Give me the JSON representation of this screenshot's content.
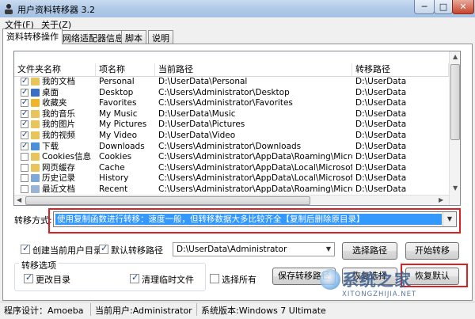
{
  "window": {
    "title": "用户资料转移器 3.2",
    "controls": {
      "minimize": "─",
      "maximize": "□",
      "close": "✕"
    }
  },
  "menu": [
    {
      "label": "文件(F)"
    },
    {
      "label": "关于(Z)"
    }
  ],
  "tabs": [
    {
      "label": "资料转移操作",
      "active": true
    },
    {
      "label": "网络适配器信息",
      "active": false
    },
    {
      "label": "脚本",
      "active": false
    },
    {
      "label": "说明",
      "active": false
    }
  ],
  "table": {
    "columns": [
      "文件夹名称",
      "项名称",
      "当前路径",
      "转移路径"
    ],
    "rows": [
      {
        "checked": true,
        "icon": "folder-icon",
        "name": "我的文档",
        "item": "Personal",
        "current": "D:\\UserData\\Personal",
        "target": "D:\\UserData"
      },
      {
        "checked": true,
        "icon": "desktop-icon",
        "name": "桌面",
        "item": "Desktop",
        "current": "C:\\Users\\Administrator\\Desktop",
        "target": "D:\\UserData"
      },
      {
        "checked": true,
        "icon": "favorites-icon",
        "name": "收藏夹",
        "item": "Favorites",
        "current": "C:\\Users\\Administrator\\Favorites",
        "target": "D:\\UserData"
      },
      {
        "checked": true,
        "icon": "music-icon",
        "name": "我的音乐",
        "item": "My Music",
        "current": "D:\\UserData\\Music",
        "target": "D:\\UserData"
      },
      {
        "checked": true,
        "icon": "pictures-icon",
        "name": "我的图片",
        "item": "My Pictures",
        "current": "D:\\UserData\\Pictures",
        "target": "D:\\UserData"
      },
      {
        "checked": true,
        "icon": "video-icon",
        "name": "我的视频",
        "item": "My Video",
        "current": "D:\\UserData\\Video",
        "target": "D:\\UserData"
      },
      {
        "checked": true,
        "icon": "download-icon",
        "name": "下载",
        "item": "Downloads",
        "current": "C:\\Users\\Administrator\\Downloads",
        "target": "D:\\UserData"
      },
      {
        "checked": false,
        "icon": "folder-icon",
        "name": "Cookies信息",
        "item": "Cookies",
        "current": "C:\\Users\\Administrator\\AppData\\Roaming\\Microsoft\\Win...",
        "target": "D:\\UserData"
      },
      {
        "checked": false,
        "icon": "folder-icon",
        "name": "网页缓存",
        "item": "Cache",
        "current": "C:\\Users\\Administrator\\AppData\\Local\\Microsoft\\Window...",
        "target": "D:\\UserData"
      },
      {
        "checked": false,
        "icon": "history-icon",
        "name": "历史记录",
        "item": "History",
        "current": "C:\\Users\\Administrator\\AppData\\Local\\Microsoft\\Window...",
        "target": "D:\\UserData"
      },
      {
        "checked": false,
        "icon": "document-icon",
        "name": "最近文档",
        "item": "Recent",
        "current": "C:\\Users\\Administrator\\AppData\\Roaming\\Microsoft\\Win...",
        "target": "D:\\UserData"
      }
    ]
  },
  "transfer_mode": {
    "label": "转移方式:",
    "value": "使用复制函数进行转移：速度一般，但转移数据大多比较齐全【复制后删除原目录】"
  },
  "options": {
    "create_user_dir": {
      "label": "创建当前用户目录",
      "checked": true
    },
    "default_path": {
      "label": "默认转移路径",
      "checked": true
    },
    "path_value": "D:\\UserData\\Administrator",
    "choose_path_button": "选择路径",
    "start_button": "开始转移",
    "group_title": "转移选项",
    "change_dir": {
      "label": "更改目录",
      "checked": true
    },
    "clean_temp": {
      "label": "清理临时文件",
      "checked": true
    },
    "select_all": {
      "label": "选择所有",
      "checked": false
    },
    "save_path_button": "保存转移路径",
    "restore_choice_button": "恢复选择",
    "restore_default_button": "恢复默认"
  },
  "watermark": {
    "title": "系统之家",
    "url": "XITONGZHIJIA.NET"
  },
  "status": {
    "designer": "程序设计：Amoeba",
    "user": "当前用户:Administrator",
    "os": "系统版本:Windows 7 Ultimate"
  },
  "colors": {
    "selection": "#3399ff",
    "highlight_box": "#e02020"
  }
}
